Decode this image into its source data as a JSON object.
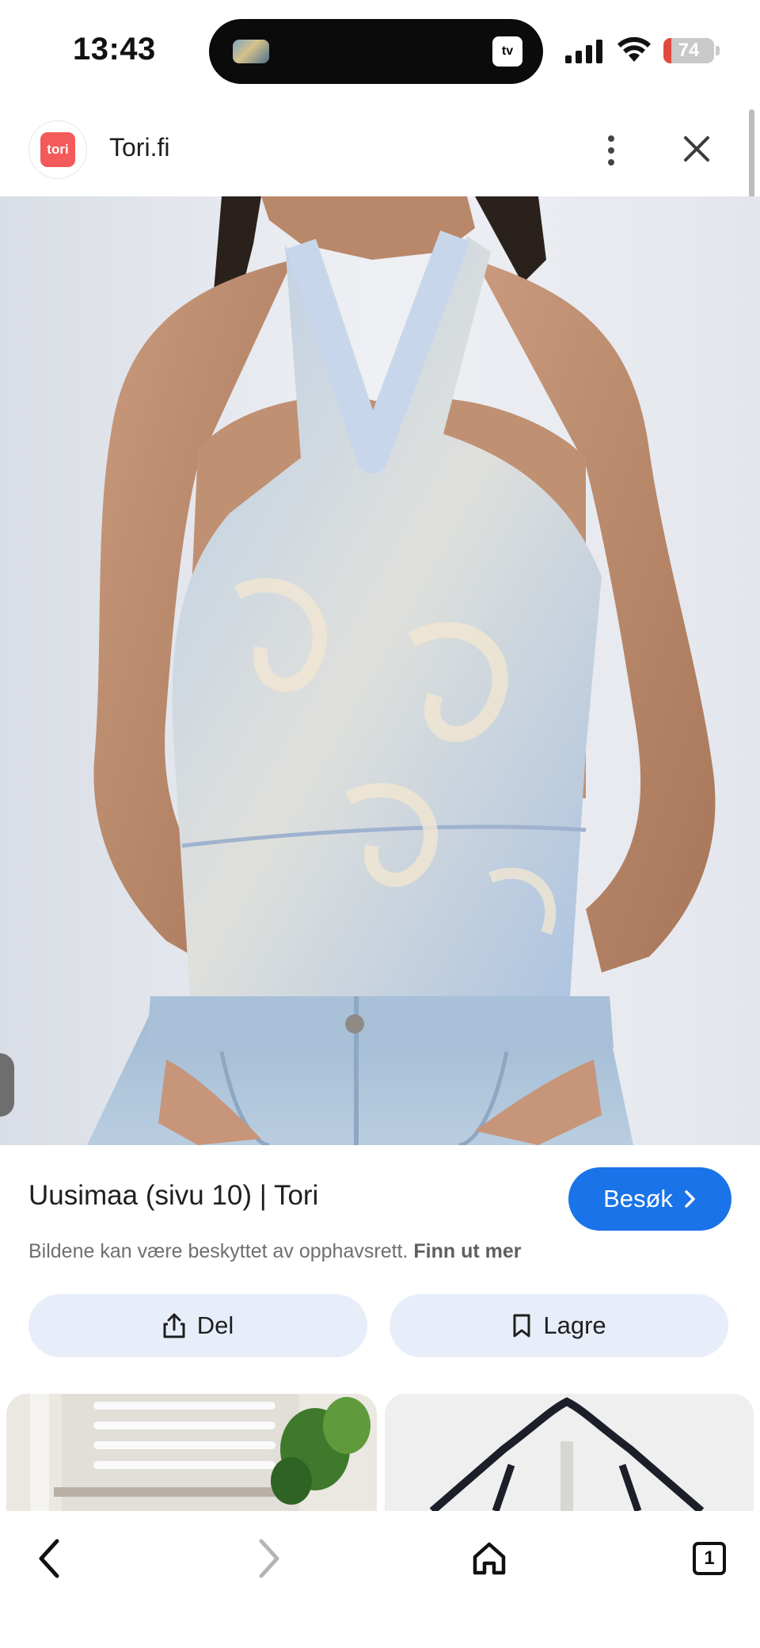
{
  "status_bar": {
    "time": "13:43",
    "battery_level": "74",
    "battery_fraction": 0.74,
    "island_app_icon": "apple-tv-icon",
    "island_app_label": "tv"
  },
  "site": {
    "logo_text": "tori",
    "name": "Tori.fi",
    "brand_color": "#f35a5a"
  },
  "result": {
    "title": "Uusimaa (sivu 10) | Tori",
    "visit_label": "Besøk",
    "copyright_text": "Bildene kan være beskyttet av opphavsrett.",
    "learn_more_label": "Finn ut mer",
    "share_label": "Del",
    "save_label": "Lagre"
  },
  "toolbar": {
    "back_icon": "chevron-left-icon",
    "forward_icon": "chevron-right-icon",
    "home_icon": "home-icon",
    "tab_count": "1"
  },
  "colors": {
    "accent": "#1a73e8",
    "action_bg": "#e8eef9"
  }
}
